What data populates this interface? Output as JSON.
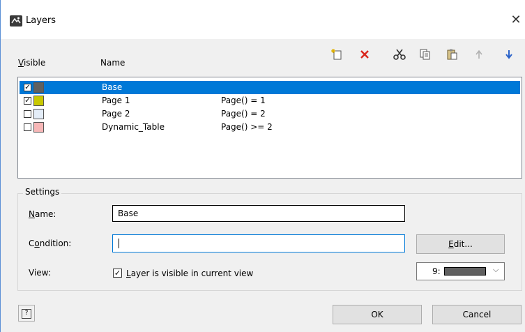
{
  "window": {
    "title": "Layers",
    "close_glyph": "✕"
  },
  "columns": {
    "visible": "Visible",
    "name": "Name"
  },
  "toolbar": [
    {
      "name": "new-layer-icon",
      "color": "#c8a93a"
    },
    {
      "name": "delete-icon",
      "color": "#d9261c"
    },
    {
      "name": "cut-icon",
      "color": "#444444"
    },
    {
      "name": "copy-icon",
      "color": "#444444"
    },
    {
      "name": "paste-icon",
      "color": "#444444"
    },
    {
      "name": "move-up-icon",
      "color": "#b0b0b0",
      "disabled": true
    },
    {
      "name": "move-down-icon",
      "color": "#2a62c9"
    }
  ],
  "layers": [
    {
      "checked": true,
      "color": "#606060",
      "name": "Base",
      "condition": "",
      "selected": true
    },
    {
      "checked": true,
      "color": "#c8c800",
      "name": "Page 1",
      "condition": "Page() = 1",
      "selected": false
    },
    {
      "checked": false,
      "color": "#e4edf8",
      "name": "Page 2",
      "condition": "Page() = 2",
      "selected": false
    },
    {
      "checked": false,
      "color": "#f7b7b7",
      "name": "Dynamic_Table",
      "condition": "Page() >= 2",
      "selected": false
    }
  ],
  "settings": {
    "title": "Settings",
    "name_label": "Name:",
    "name_value": "Base",
    "condition_label": "Condition:",
    "condition_value": "",
    "edit_button": "Edit...",
    "view_label": "View:",
    "visible_checkbox": "Layer is visible in current view",
    "visible_checked": true,
    "color_combo_value": "9:",
    "color_combo_swatch": "#606060"
  },
  "footer": {
    "help_glyph": "?",
    "ok": "OK",
    "cancel": "Cancel"
  },
  "colors": {
    "accent": "#0078d7",
    "focus_border": "#0078d7"
  }
}
